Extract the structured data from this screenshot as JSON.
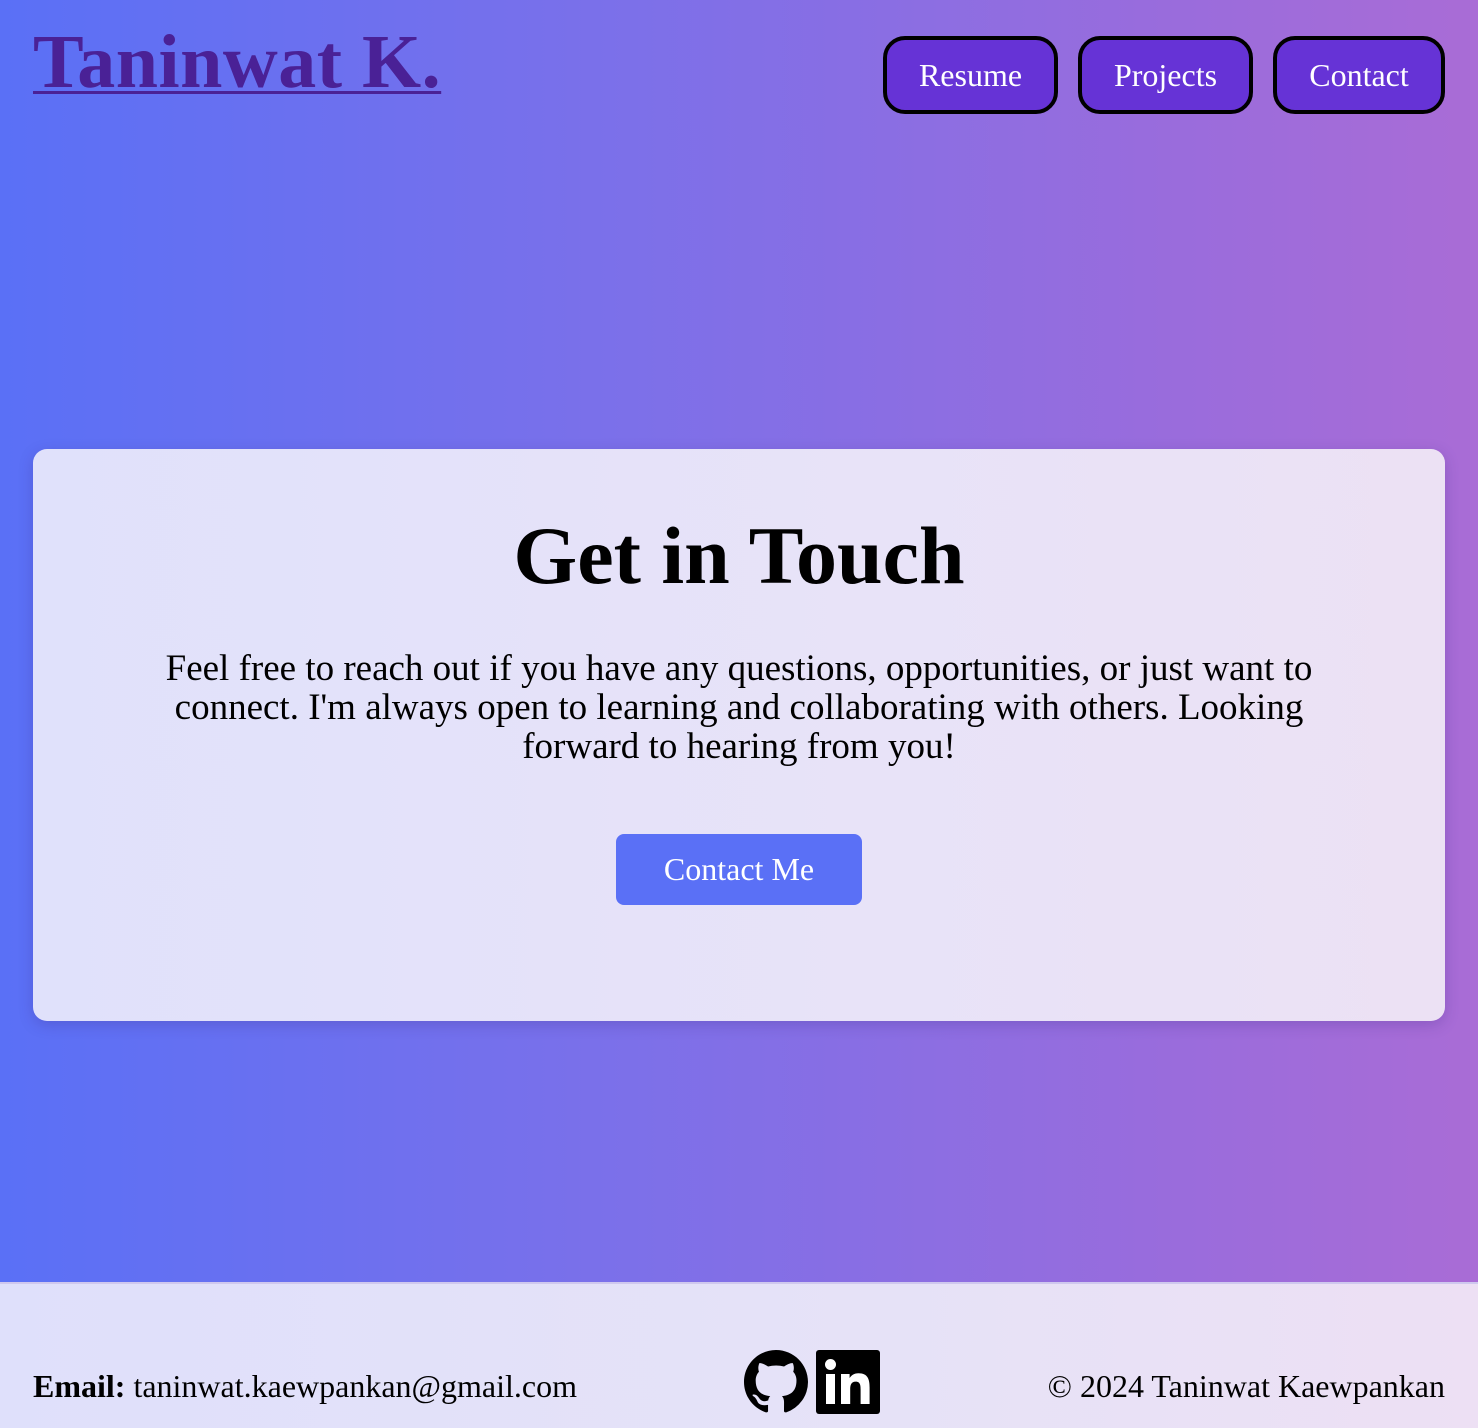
{
  "header": {
    "logo": "Taninwat K.",
    "nav": [
      "Resume",
      "Projects",
      "Contact"
    ]
  },
  "main": {
    "title": "Get in Touch",
    "body": "Feel free to reach out if you have any questions, opportunities, or just want to connect. I'm always open to learning and collaborating with others. Looking forward to hearing from you!",
    "cta_label": "Contact Me"
  },
  "footer": {
    "email_label": "Email:",
    "email_value": "taninwat.kaewpankan@gmail.com",
    "copyright": "© 2024 Taninwat Kaewpankan",
    "social_icons": [
      "github-icon",
      "linkedin-icon"
    ]
  },
  "colors": {
    "gradient_start": "#5a70f6",
    "gradient_end": "#a96cd6",
    "logo": "#4a2196",
    "nav_button": "#6633d6",
    "cta_button": "#5a70f6"
  }
}
